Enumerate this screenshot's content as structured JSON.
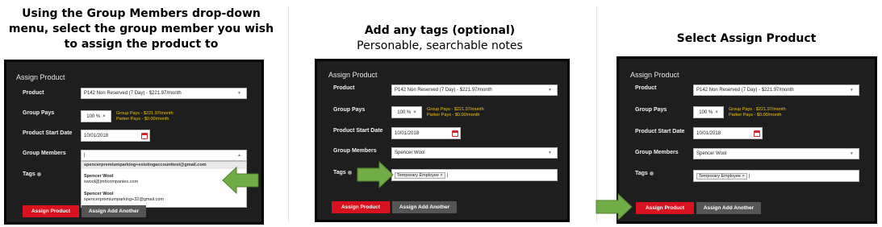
{
  "captions": {
    "col1": [
      "Using the Group Members drop-down",
      "menu, select the group member you wish",
      "to assign the product to"
    ],
    "col2_title": "Add any tags (optional)",
    "col2_sub": "Personable, searchable notes",
    "col3_title": "Select Assign Product"
  },
  "form": {
    "title": "Assign Product",
    "product_label": "Product",
    "product_value": "P142 Non Reserved (7 Day) - $221.97/month",
    "group_pays_label": "Group Pays",
    "percent_value": "100 %",
    "clear_symbol": "×",
    "group_pays_text": "Group Pays - $221.97/month",
    "parker_pays_text": "Parker Pays - $0.00/month",
    "start_date_label": "Product Start Date",
    "start_date_value": "10/01/2018",
    "group_members_label": "Group Members",
    "tags_label": "Tags",
    "assign_button": "Assign Product",
    "assign_another_button": "Assign Add Another"
  },
  "panel1": {
    "group_members_value": "|",
    "dropdown_options": [
      {
        "line1": "spencerpremiumparking+existingaccounttest@gmail.com",
        "line2": ""
      },
      {
        "line1": "Spencer Wool",
        "line2": "swool@jmhcompanies.com"
      },
      {
        "line1": "Spencer Wool",
        "line2": "spencerpremiumparking+32@gmail.com"
      }
    ]
  },
  "panel2": {
    "group_members_value": "Spencer Wool",
    "tag": "Temporary Employee"
  },
  "panel3": {
    "group_members_value": "Spencer Wool",
    "tag": "Temporary Employee"
  },
  "colors": {
    "arrow": "#70ad47",
    "arrow_stroke": "#507e32",
    "accent_red": "#d9121f",
    "pays_text": "#f5c400"
  },
  "icons": {
    "calendar": "calendar-icon",
    "caret": "chevron-down-icon",
    "info": "info-icon",
    "arrow": "green-arrow"
  }
}
